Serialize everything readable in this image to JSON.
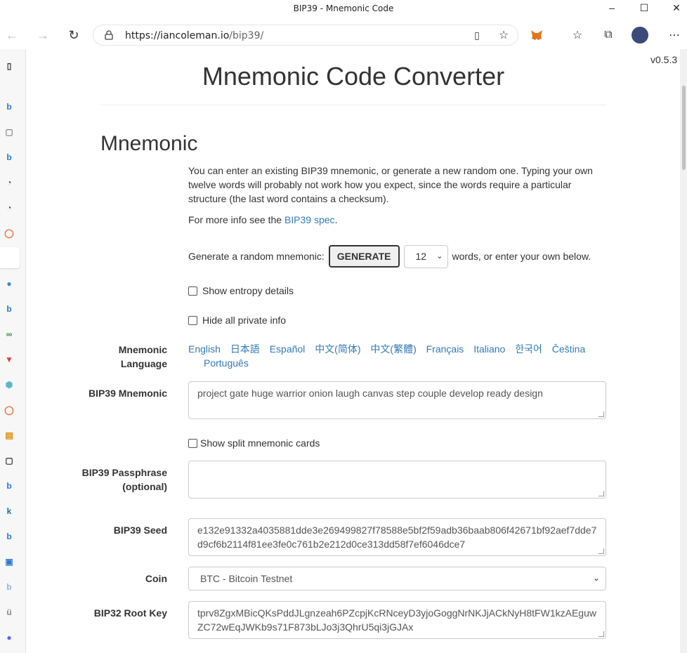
{
  "window": {
    "title": "BIP39 - Mnemonic Code"
  },
  "browser": {
    "url_host": "https://iancoleman.io",
    "url_path": "/bip39/"
  },
  "page": {
    "version": "v0.5.3",
    "title": "Mnemonic Code Converter",
    "section_heading": "Mnemonic",
    "intro": "You can enter an existing BIP39 mnemonic, or generate a new random one. Typing your own twelve words will probably not work how you expect, since the words require a particular structure (the last word contains a checksum).",
    "more_info_prefix": "For more info see the ",
    "more_info_link": "BIP39 spec",
    "more_info_suffix": ".",
    "generate_prefix": "Generate a random mnemonic:",
    "generate_button": "GENERATE",
    "word_count": "12",
    "generate_suffix": "words, or enter your own below.",
    "show_entropy": "Show entropy details",
    "hide_private": "Hide all private info",
    "mnemonic_language_label": "Mnemonic Language",
    "languages": [
      "English",
      "日本語",
      "Español",
      "中文(简体)",
      "中文(繁體)",
      "Français",
      "Italiano",
      "한국어",
      "Čeština",
      "Português"
    ],
    "bip39_mnemonic_label": "BIP39 Mnemonic",
    "bip39_mnemonic_value": "project gate huge warrior onion laugh canvas step couple develop ready design",
    "show_split": "Show split mnemonic cards",
    "passphrase_label": "BIP39 Passphrase (optional)",
    "passphrase_value": "",
    "seed_label": "BIP39 Seed",
    "seed_value": "e132e91332a4035881dde3e269499827f78588e5bf2f59adb36baab806f42671bf92aef7dde7d9cf6b2114f81ee3fe0c761b2e212d0ce313dd58f7ef6046dce7",
    "coin_label": "Coin",
    "coin_value": "BTC - Bitcoin Testnet",
    "root_key_label": "BIP32 Root Key",
    "root_key_value": "tprv8ZgxMBicQKsPddJLgnzeah6PZcpjKcRNceyD3yjoGoggNrNKJjACkNyH8tFW1kzAEguwZC72wEqJWKb9s71F873bLJo3j3QhrU5qi3jGJAx"
  }
}
